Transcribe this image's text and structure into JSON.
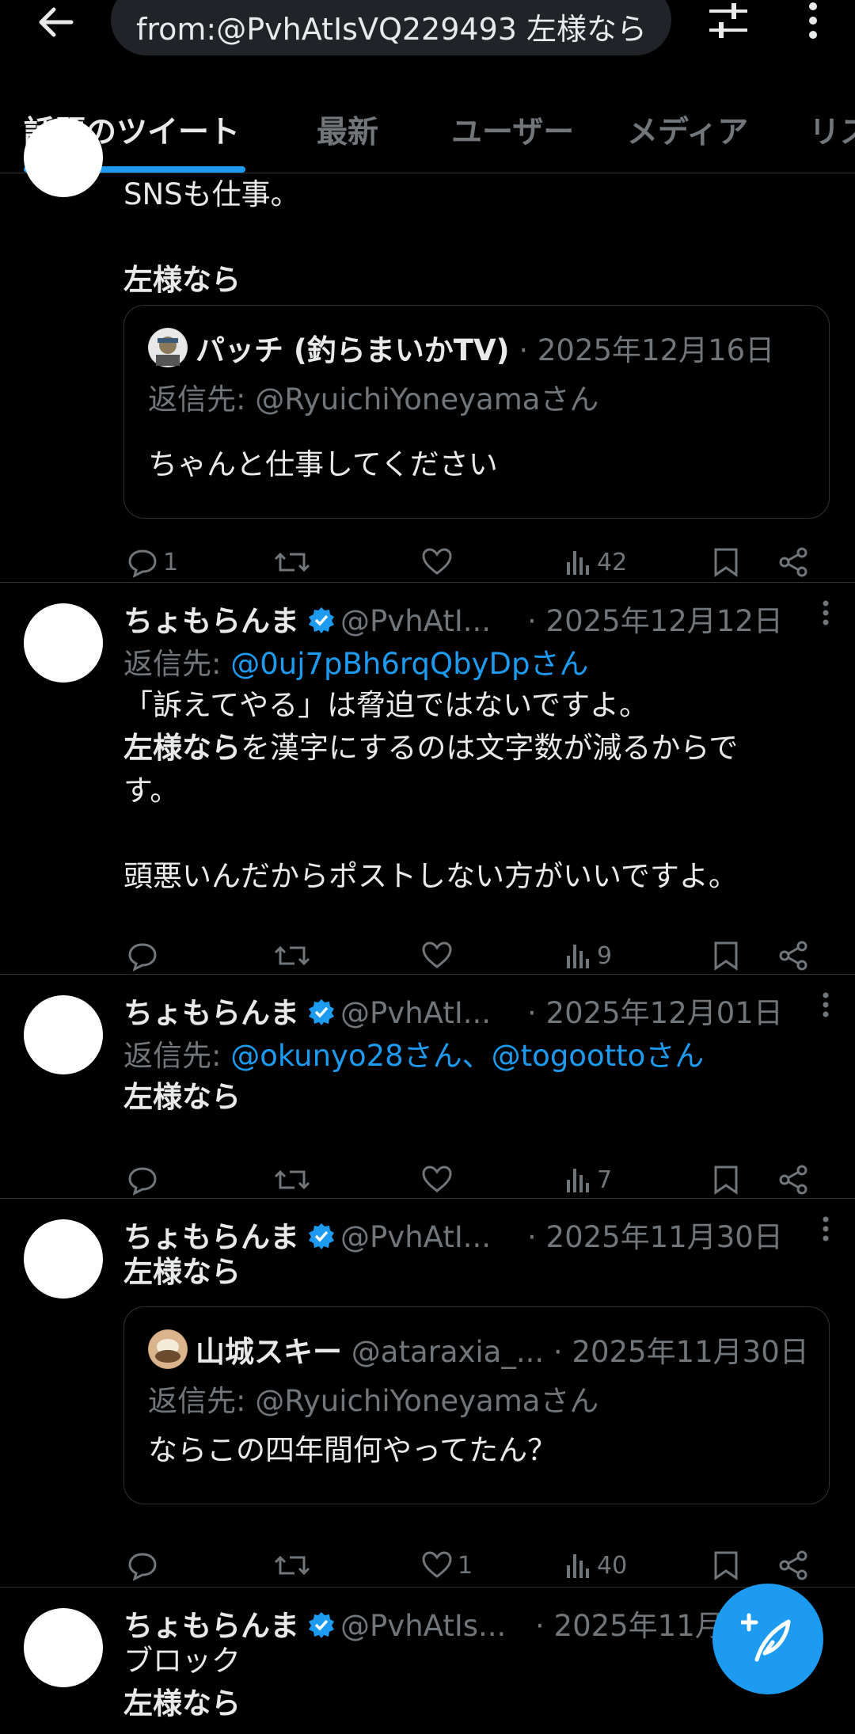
{
  "search": {
    "query": "from:@PvhAtIsVQ229493 左様なら"
  },
  "tabs": [
    "話題のツイート",
    "最新",
    "ユーザー",
    "メディア",
    "リス"
  ],
  "colors": {
    "accent": "#1d9bf0",
    "background": "#000000",
    "muted": "#71767b"
  },
  "tweets": [
    {
      "text_lines": [
        "SNSも仕事。",
        "",
        "左様なら"
      ],
      "quote": {
        "name": "パッチ (釣らまいかTV)",
        "date": "· 2025年12月16日",
        "reply_to": "返信先: @RyuichiYoneyamaさん",
        "text": "ちゃんと仕事してください"
      },
      "replies": "1",
      "retweets": "",
      "likes": "",
      "views": "42"
    },
    {
      "name": "ちょもらんま",
      "handle": "@PvhAtI...",
      "date": "· 2025年12月12日",
      "reply_label": "返信先: ",
      "reply_users": "@0uj7pBh6rqQbyDpさん",
      "text_lines": [
        "「訴えてやる」は脅迫ではないですよ。",
        "を漢字にするのは文字数が減るからで",
        "す。",
        "",
        "頭悪いんだからポストしない方がいいですよ。"
      ],
      "bold_word": "左様なら",
      "replies": "",
      "retweets": "",
      "likes": "",
      "views": "9"
    },
    {
      "name": "ちょもらんま",
      "handle": "@PvhAtI...",
      "date": "· 2025年12月01日",
      "reply_label": "返信先: ",
      "reply_users": "@okunyo28さん、@togoottoさん",
      "text": "左様なら",
      "replies": "",
      "retweets": "",
      "likes": "",
      "views": "7"
    },
    {
      "name": "ちょもらんま",
      "handle": "@PvhAtI...",
      "date": "· 2025年11月30日",
      "text": "左様なら",
      "quote": {
        "name": "山城スキー",
        "handle": "@ataraxia_...",
        "date": "· 2025年11月30日",
        "reply_to": "返信先: @RyuichiYoneyamaさん",
        "text": "ならこの四年間何やってたん？"
      },
      "replies": "",
      "retweets": "",
      "likes": "1",
      "views": "40"
    },
    {
      "name": "ちょもらんま",
      "handle": "@PvhAtIs...",
      "date": "· 2025年11月",
      "text_lines": [
        "ブロック",
        "左様なら"
      ]
    }
  ]
}
